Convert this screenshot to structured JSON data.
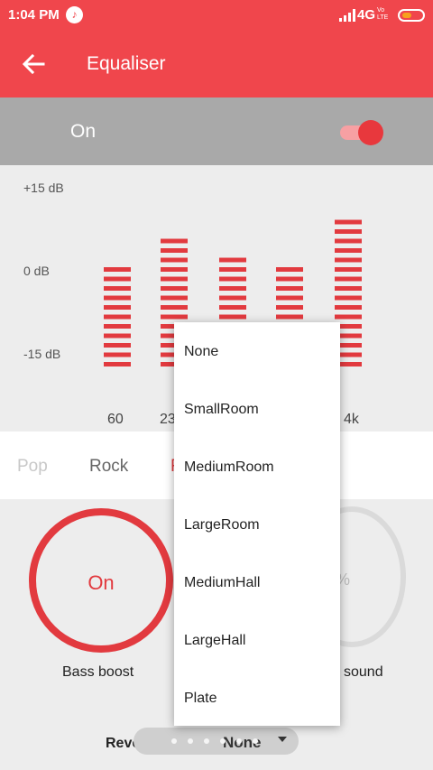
{
  "status_bar": {
    "time": "1:04 PM",
    "network": "4G",
    "volte": "Vo LTE",
    "icons": [
      "music-icon",
      "signal-icon",
      "battery-icon"
    ]
  },
  "app_bar": {
    "title": "Equaliser",
    "back_icon": "arrow-left-icon"
  },
  "toggle": {
    "label": "On",
    "state": true
  },
  "equalizer": {
    "db_labels": {
      "top": "+15 dB",
      "mid": "0 dB",
      "bottom": "-15 dB"
    },
    "frequency_labels": {
      "first": "60",
      "second": "23",
      "last": "4k"
    },
    "band_levels_db": [
      0,
      5,
      2,
      0,
      8
    ],
    "accent_color": "#e23a3f"
  },
  "presets": {
    "items": [
      "Pop",
      "Rock",
      "F"
    ]
  },
  "bass_boost": {
    "value": "On",
    "label": "Bass boost"
  },
  "virtualizer": {
    "label": "sound",
    "value_fragment": "%"
  },
  "reverb": {
    "label": "Reverb:",
    "selected": "None",
    "options": [
      "None",
      "SmallRoom",
      "MediumRoom",
      "LargeRoom",
      "MediumHall",
      "LargeHall",
      "Plate"
    ]
  }
}
